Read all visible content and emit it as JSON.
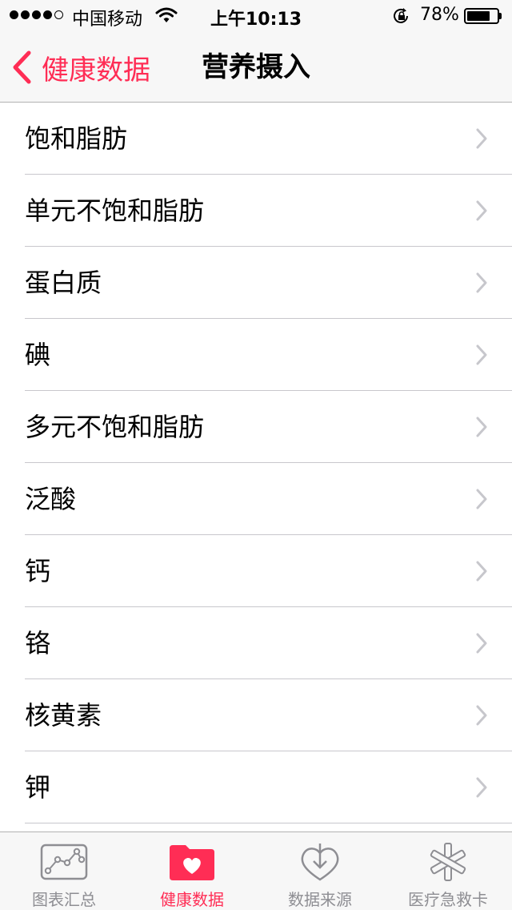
{
  "status_bar": {
    "carrier": "中国移动",
    "time": "上午10:13",
    "battery_percent": "78%",
    "battery_level": 0.78,
    "signal_bars_filled": 4,
    "signal_bars_total": 5
  },
  "nav": {
    "back_label": "健康数据",
    "title": "营养摄入"
  },
  "list": {
    "items": [
      {
        "label": "饱和脂肪"
      },
      {
        "label": "单元不饱和脂肪"
      },
      {
        "label": "蛋白质"
      },
      {
        "label": "碘"
      },
      {
        "label": "多元不饱和脂肪"
      },
      {
        "label": "泛酸"
      },
      {
        "label": "钙"
      },
      {
        "label": "铬"
      },
      {
        "label": "核黄素"
      },
      {
        "label": "钾"
      }
    ]
  },
  "tab_bar": {
    "tabs": [
      {
        "label": "图表汇总",
        "icon": "chart-icon"
      },
      {
        "label": "健康数据",
        "icon": "health-folder-icon"
      },
      {
        "label": "数据来源",
        "icon": "download-heart-icon"
      },
      {
        "label": "医疗急救卡",
        "icon": "medical-id-icon"
      }
    ],
    "active_index": 1
  },
  "colors": {
    "accent": "#ff2d55",
    "inactive_tab": "#8e8e93",
    "bar_background": "#f7f7f7",
    "separator": "#c8c7cc",
    "chevron": "#c7c7cc"
  }
}
